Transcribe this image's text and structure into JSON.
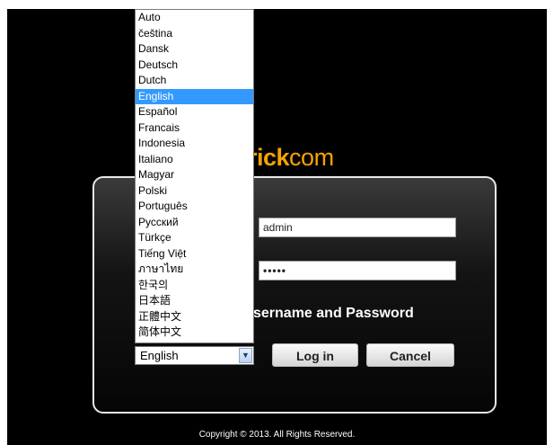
{
  "brand": {
    "logo_bold": "rick",
    "logo_rest": "com",
    "color": "#f5a300"
  },
  "login": {
    "username": "admin",
    "password_mask": "•••••",
    "prompt": "sername and Password",
    "login_label": "Log in",
    "cancel_label": "Cancel"
  },
  "language": {
    "selected": "English",
    "options": [
      "Auto",
      "čeština",
      "Dansk",
      "Deutsch",
      "Dutch",
      "English",
      "Español",
      "Francais",
      "Indonesia",
      "Italiano",
      "Magyar",
      "Polski",
      "Português",
      "Русский",
      "Türkçe",
      "Tiếng Việt",
      "ภาษาไทย",
      "한국의",
      "日本語",
      "正體中文",
      "简体中文"
    ]
  },
  "footer": {
    "copyright": "Copyright © 2013. All Rights Reserved."
  }
}
